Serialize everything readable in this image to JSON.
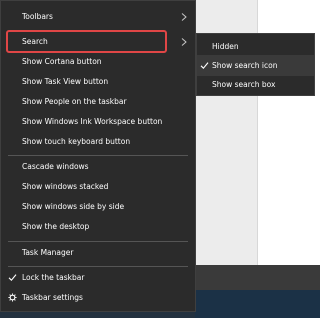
{
  "menu": {
    "items": [
      {
        "label": "Toolbars"
      },
      {
        "label": "Search"
      },
      {
        "label": "Show Cortana button"
      },
      {
        "label": "Show Task View button"
      },
      {
        "label": "Show People on the taskbar"
      },
      {
        "label": "Show Windows Ink Workspace button"
      },
      {
        "label": "Show touch keyboard button"
      },
      {
        "label": "Cascade windows"
      },
      {
        "label": "Show windows stacked"
      },
      {
        "label": "Show windows side by side"
      },
      {
        "label": "Show the desktop"
      },
      {
        "label": "Task Manager"
      },
      {
        "label": "Lock the taskbar",
        "checked": true
      },
      {
        "label": "Taskbar settings",
        "icon": "gear-icon"
      }
    ]
  },
  "submenu": {
    "items": [
      {
        "label": "Hidden"
      },
      {
        "label": "Show search icon",
        "checked": true
      },
      {
        "label": "Show search box"
      }
    ]
  },
  "colors": {
    "menu_bg": "#2b2b2b",
    "highlight_border": "#e04646",
    "text": "#ffffff",
    "taskbar": "#23313f"
  }
}
